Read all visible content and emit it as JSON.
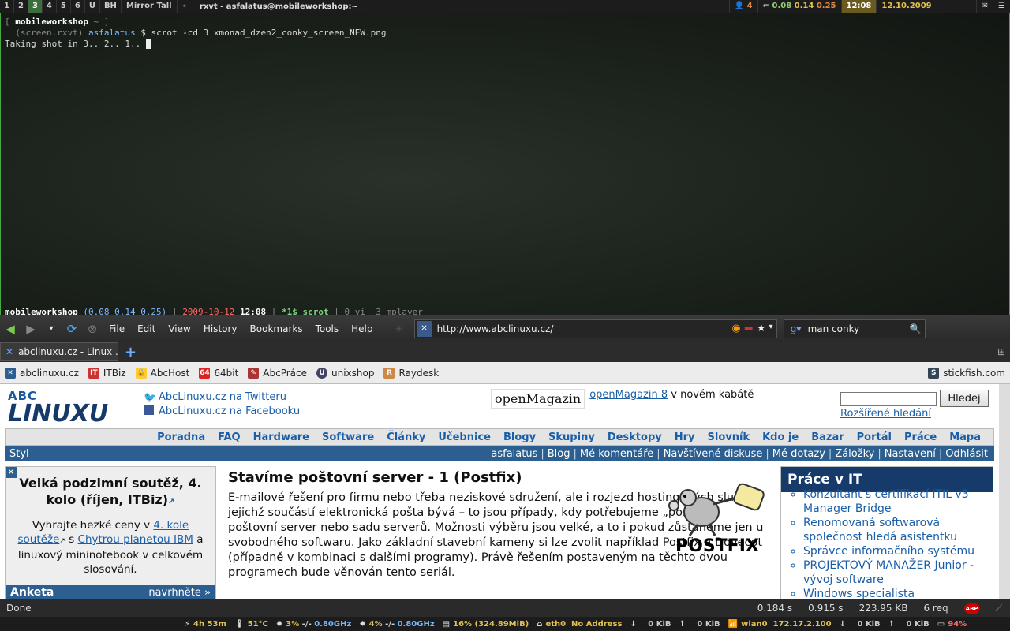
{
  "topbar": {
    "workspaces": [
      "1",
      "2",
      "3",
      "4",
      "5",
      "6",
      "U",
      "BH"
    ],
    "active_workspace": "3",
    "layout": "Mirror Tall",
    "window_title": "rxvt - asfalatus@mobileworkshop:~",
    "users_count": "4",
    "load": [
      "0.08",
      "0.14",
      "0.25"
    ],
    "time": "12:08",
    "date": "12.10.2009"
  },
  "terminal": {
    "prompt_line1": "[ mobileworkshop ~ ]",
    "prompt_host": "mobileworkshop",
    "prompt_dir": "~",
    "prompt_prefix": "(screen.rxvt)",
    "prompt_user": "asfalatus",
    "prompt_symbol": "$",
    "command": "scrot -cd 3 xmonad_dzen2_conky_screen_NEW.png",
    "output": "Taking shot in 3.. 2.. 1..",
    "screen_host": "mobileworkshop",
    "screen_load": "(0.08 0.14 0.25)",
    "screen_date": "2009-10-12",
    "screen_time": "12:08",
    "screen_win_active": "*1$ scrot",
    "screen_win_2": "0 vi",
    "screen_win_3": "3 mplayer"
  },
  "browser": {
    "menus": [
      "File",
      "Edit",
      "View",
      "History",
      "Bookmarks",
      "Tools",
      "Help"
    ],
    "url": "http://www.abclinuxu.cz/",
    "search_text": "man conky",
    "tab_title": "abclinuxu.cz - Linux ...",
    "bookmarks": [
      "abclinuxu.cz",
      "ITBiz",
      "AbcHost",
      "64bit",
      "AbcPráce",
      "unixshop",
      "Raydesk"
    ],
    "bookmark_right": "stickfish.com"
  },
  "page": {
    "logo_top": "ABC",
    "logo_main": "LINUXU",
    "twitter_link": "AbcLinuxu.cz na Twitteru",
    "facebook_link": "AbcLinuxu.cz na Facebooku",
    "om_logo": "openMagazin",
    "om_link": "openMagazin 8",
    "om_rest": " v novém kabátě",
    "search_button": "Hledej",
    "advanced_search": "Rozšířené hledání",
    "main_menu": [
      "Poradna",
      "FAQ",
      "Hardware",
      "Software",
      "Články",
      "Učebnice",
      "Blogy",
      "Skupiny",
      "Desktopy",
      "Hry",
      "Slovník",
      "Kdo je",
      "Bazar",
      "Portál",
      "Práce",
      "Mapa"
    ],
    "styl": "Styl",
    "user_menu": [
      "asfalatus",
      "Blog",
      "Mé komentáře",
      "Navštívené diskuse",
      "Mé dotazy",
      "Záložky",
      "Nastavení",
      "Odhlásit"
    ],
    "promo_title": "Velká podzimní soutěž, 4. kolo (říjen, ITBiz)",
    "promo_p1": "Vyhrajte hezké ceny v ",
    "promo_link1": "4. kole soutěže",
    "promo_p2": " s ",
    "promo_link2": "Chytrou planetou IBM",
    "promo_p3": " a linuxový mininotebook v celkovém slosování.",
    "anketa": "Anketa",
    "anketa_nav": "navrhněte »",
    "article_title": "Stavíme poštovní server - 1 (Postfix)",
    "article_text": "E-mailové řešení pro firmu nebo třeba neziskové sdružení, ale i rozjezd hostingových služeb, jejichž součástí elektronická pošta bývá – to jsou případy, kdy potřebujeme „postavit“ poštovní server nebo sadu serverů. Možnosti výběru jsou velké, a to i pokud zůstaneme jen u svobodného softwaru. Jako základní stavební kameny si lze zvolit například Postfix a Dovecot (případně v kombinaci s dalšími programy). Právě řešením postaveným na těchto dvou programech bude věnován tento seriál.",
    "postfix_word": "POSTFIX",
    "jobs_title": "Práce v IT",
    "jobs": [
      "Konzultant s certifikací ITIL v3 Manager Bridge",
      "Renomovaná softwarová společnost hledá asistentku",
      "Správce informačního systému",
      "PROJEKTOVÝ MANAŽER Junior - vývoj software",
      "Windows specialista"
    ]
  },
  "status": {
    "done": "Done",
    "t1": "0.184 s",
    "t2": "0.915 s",
    "size": "223.95 KB",
    "req": "6 req",
    "abp": "ABP"
  },
  "bottombar": {
    "battery_time": "4h 53m",
    "temp": "51°C",
    "cpu1": "3%",
    "cpu1_freq": "0.80GHz",
    "cpu2": "4%",
    "cpu2_freq": "0.80GHz",
    "mem": "16% (324.89MiB)",
    "eth": "eth0",
    "eth_addr": "No Address",
    "eth_down": "0 KiB",
    "eth_up": "0 KiB",
    "wlan": "wlan0",
    "wlan_addr": "172.17.2.100",
    "wlan_down": "0 KiB",
    "wlan_up": "0 KiB",
    "battery": "94%"
  }
}
